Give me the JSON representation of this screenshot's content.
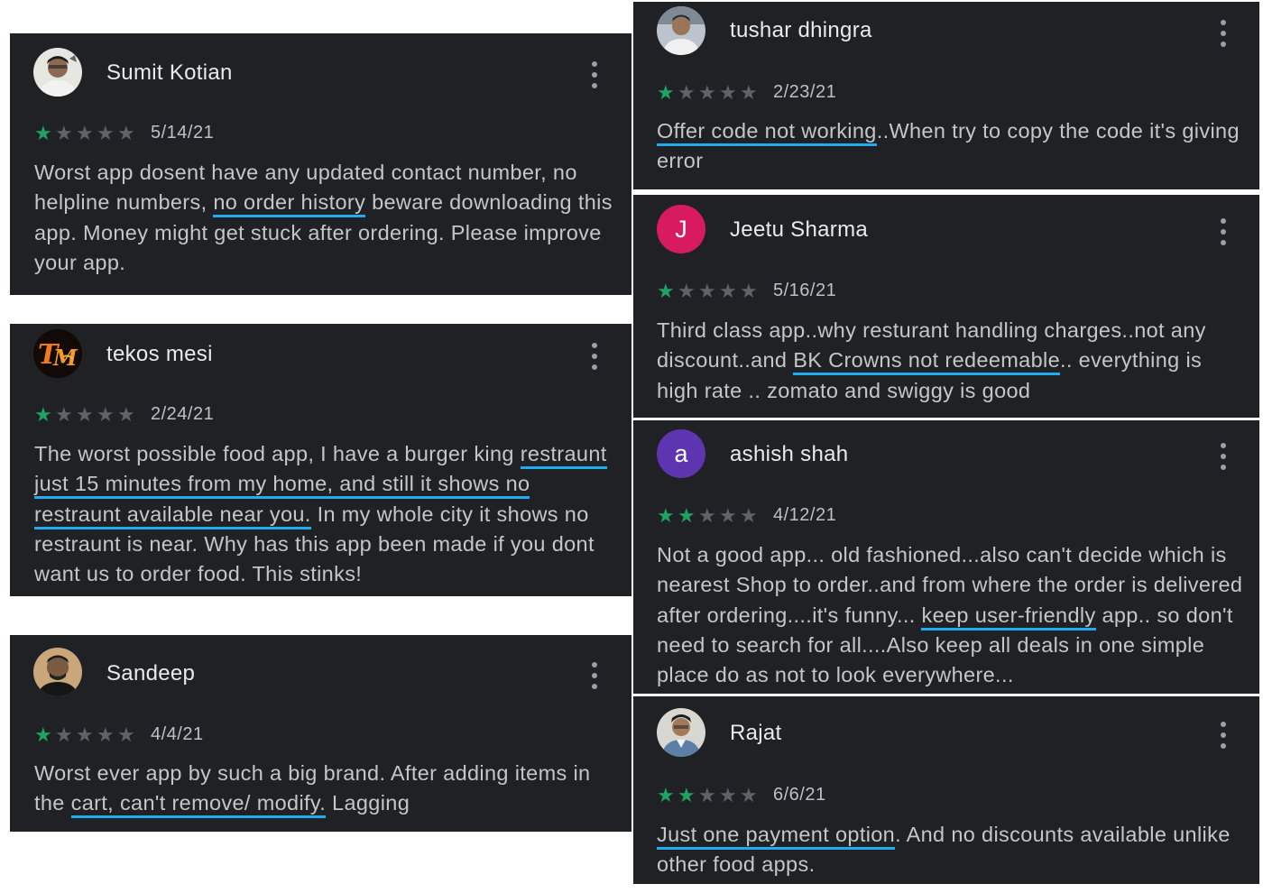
{
  "reviews": [
    {
      "author": "Sumit Kotian",
      "avatar_icon": "user-photo",
      "stars_filled": 1,
      "stars_total": 5,
      "date": "5/14/21",
      "text": [
        {
          "t": "Worst app dosent have any updated contact number, no helpline numbers, "
        },
        {
          "t": "no order history",
          "underline": true
        },
        {
          "t": " beware downloading this app. Money might get stuck after ordering. Please improve your app."
        }
      ]
    },
    {
      "author": "tekos mesi",
      "avatar_icon": "tm-logo",
      "stars_filled": 1,
      "stars_total": 5,
      "date": "2/24/21",
      "text": [
        {
          "t": "The worst possible food app, I have a burger king "
        },
        {
          "t": "restraunt just 15 minutes from my home, and still it shows no restraunt available near you.",
          "underline": true
        },
        {
          "t": " In my whole city it shows no restraunt is near. Why has this app been made if you dont want us to order food. This stinks!"
        }
      ]
    },
    {
      "author": "Sandeep",
      "avatar_icon": "user-photo",
      "stars_filled": 1,
      "stars_total": 5,
      "date": "4/4/21",
      "text": [
        {
          "t": "Worst ever app by such a big brand. After adding items in the "
        },
        {
          "t": "cart, can't remove/ modify.",
          "underline": true
        },
        {
          "t": " Lagging"
        }
      ]
    },
    {
      "author": "tushar dhingra",
      "avatar_icon": "user-photo",
      "stars_filled": 1,
      "stars_total": 5,
      "date": "2/23/21",
      "text": [
        {
          "t": "Offer code not working",
          "underline": true
        },
        {
          "t": "..When try to copy the code it's giving error"
        }
      ]
    },
    {
      "author": "Jeetu Sharma",
      "avatar_letter": "J",
      "avatar_color": "#d81b60",
      "stars_filled": 1,
      "stars_total": 5,
      "date": "5/16/21",
      "text": [
        {
          "t": "Third class app..why resturant handling charges..not any discount..and "
        },
        {
          "t": "BK Crowns not redeemable",
          "underline": true
        },
        {
          "t": ".. everything is high rate .. zomato and swiggy is good"
        }
      ]
    },
    {
      "author": "ashish shah",
      "avatar_letter": "a",
      "avatar_color": "#5e35b1",
      "stars_filled": 2,
      "stars_total": 5,
      "date": "4/12/21",
      "text": [
        {
          "t": "Not a good app... old fashioned...also can't decide which is nearest Shop to order..and from where the order is delivered after ordering....it's funny... "
        },
        {
          "t": "keep user-friendly",
          "underline": true
        },
        {
          "t": " app.. so don't need to search for all....Also keep all deals in one simple place do as not to look everywhere..."
        }
      ]
    },
    {
      "author": "Rajat",
      "avatar_icon": "user-photo",
      "stars_filled": 2,
      "stars_total": 5,
      "date": "6/6/21",
      "text": [
        {
          "t": "Just one payment option",
          "underline": true
        },
        {
          "t": ". And no discounts available unlike other food apps."
        }
      ]
    }
  ],
  "colors": {
    "card_bg": "#202124",
    "star_on": "#1ea362",
    "star_off": "#5f6368",
    "underline": "#24aaf0"
  }
}
